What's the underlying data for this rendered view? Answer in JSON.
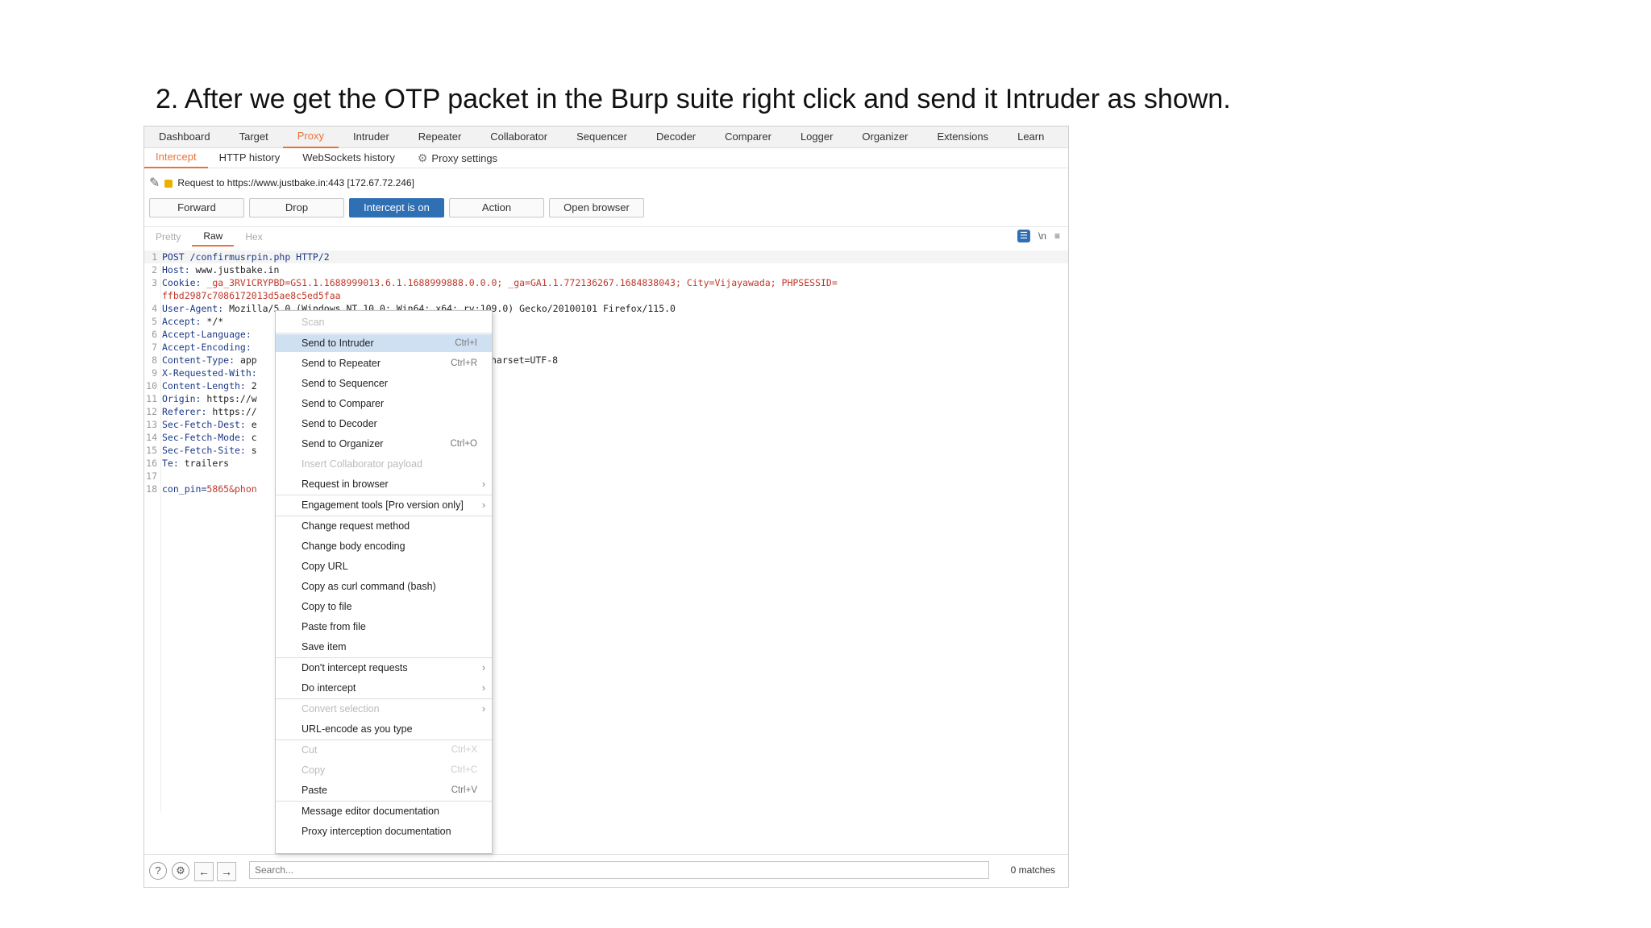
{
  "caption": "2. After we get the OTP packet in the Burp suite right click and send it Intruder as shown.",
  "top_tabs": [
    "Dashboard",
    "Target",
    "Proxy",
    "Intruder",
    "Repeater",
    "Collaborator",
    "Sequencer",
    "Decoder",
    "Comparer",
    "Logger",
    "Organizer",
    "Extensions",
    "Learn"
  ],
  "sub_tabs": [
    "Intercept",
    "HTTP history",
    "WebSockets history"
  ],
  "proxy_settings": "Proxy settings",
  "request_line": "Request to https://www.justbake.in:443  [172.67.72.246]",
  "buttons": {
    "forward": "Forward",
    "drop": "Drop",
    "intercept": "Intercept is on",
    "action": "Action",
    "open_browser": "Open browser"
  },
  "view_tabs": [
    "Pretty",
    "Raw",
    "Hex"
  ],
  "view_icons": {
    "wrap": "wrap-icon",
    "newline": "\\n",
    "menu": "≡"
  },
  "code": {
    "l1": {
      "n": "1",
      "text": "POST /confirmusrpin.php HTTP/2"
    },
    "l2": {
      "n": "2",
      "k": "Host:",
      "v": " www.justbake.in"
    },
    "l3": {
      "n": "3",
      "k": "Cookie:",
      "v": " _ga_3RV1CRYPBD=GS1.1.1688999013.6.1.1688999888.0.0.0; _ga=GA1.1.772136267.1684838043; City=Vijayawada; PHPSESSID="
    },
    "l3b": {
      "text": "ffbd2987c7086172013d5ae8c5ed5faa"
    },
    "l4": {
      "n": "4",
      "k": "User-Agent:",
      "v": " Mozilla/5.0 (Windows NT 10.0; Win64; x64; rv:109.0) Gecko/20100101 Firefox/115.0"
    },
    "l5": {
      "n": "5",
      "k": "Accept:",
      "v": " */*"
    },
    "l6": {
      "n": "6",
      "k": "Accept-Language:"
    },
    "l7": {
      "n": "7",
      "k": "Accept-Encoding:"
    },
    "l8": {
      "n": "8",
      "k": "Content-Type:",
      "v": " app",
      "tail": "harset=UTF-8"
    },
    "l9": {
      "n": "9",
      "k": "X-Requested-With:"
    },
    "l10": {
      "n": "10",
      "k": "Content-Length:",
      "v": " 2"
    },
    "l11": {
      "n": "11",
      "k": "Origin:",
      "v": " https://w"
    },
    "l12": {
      "n": "12",
      "k": "Referer:",
      "v": " https://"
    },
    "l13": {
      "n": "13",
      "k": "Sec-Fetch-Dest:",
      "v": " e"
    },
    "l14": {
      "n": "14",
      "k": "Sec-Fetch-Mode:",
      "v": " c"
    },
    "l15": {
      "n": "15",
      "k": "Sec-Fetch-Site:",
      "v": " s"
    },
    "l16": {
      "n": "16",
      "k": "Te:",
      "v": " trailers"
    },
    "l17": {
      "n": "17"
    },
    "l18": {
      "n": "18",
      "k": "con_pin=",
      "v": "5865&phon"
    }
  },
  "menu": {
    "scan": "Scan",
    "send_intruder": {
      "label": "Send to Intruder",
      "shortcut": "Ctrl+I"
    },
    "send_repeater": {
      "label": "Send to Repeater",
      "shortcut": "Ctrl+R"
    },
    "send_sequencer": "Send to Sequencer",
    "send_comparer": "Send to Comparer",
    "send_decoder": "Send to Decoder",
    "send_organizer": {
      "label": "Send to Organizer",
      "shortcut": "Ctrl+O"
    },
    "insert_collab": "Insert Collaborator payload",
    "request_browser": "Request in browser",
    "engagement": "Engagement tools [Pro version only]",
    "change_method": "Change request method",
    "change_encoding": "Change body encoding",
    "copy_url": "Copy URL",
    "copy_curl": "Copy as curl command (bash)",
    "copy_file": "Copy to file",
    "paste_file": "Paste from file",
    "save_item": "Save item",
    "dont_intercept": "Don't intercept requests",
    "do_intercept": "Do intercept",
    "convert_sel": "Convert selection",
    "url_encode": "URL-encode as you type",
    "cut": {
      "label": "Cut",
      "shortcut": "Ctrl+X"
    },
    "copy": {
      "label": "Copy",
      "shortcut": "Ctrl+C"
    },
    "paste": {
      "label": "Paste",
      "shortcut": "Ctrl+V"
    },
    "msg_doc": "Message editor documentation",
    "proxy_doc": "Proxy interception documentation"
  },
  "search": {
    "placeholder": "Search...",
    "matches": "0 matches"
  },
  "colors": {
    "accent": "#e8743b",
    "button_on": "#2f6fb3",
    "highlight": "#cfe0f3"
  }
}
